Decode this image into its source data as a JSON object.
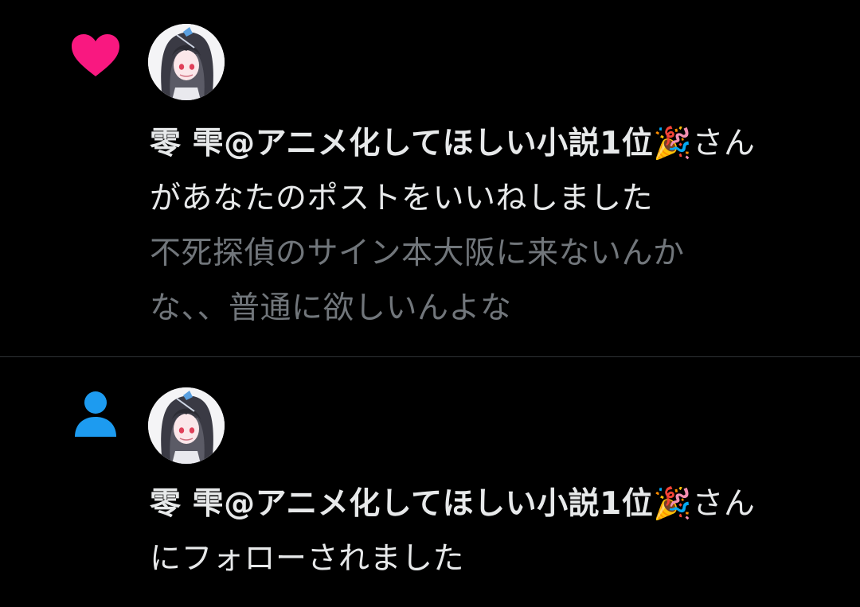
{
  "colors": {
    "background": "#000000",
    "primary_text": "#e7e9ea",
    "secondary_text": "#71767b",
    "like_heart": "#f91880",
    "follow_icon": "#1d9bf0",
    "divider": "#2f3336"
  },
  "notifications": [
    {
      "type": "like",
      "icon": "heart-icon",
      "user_name": "零 雫@アニメ化してほしい小説1位",
      "name_emoji": "🎉",
      "action_line1": "さん",
      "action_line2": "があなたのポストをいいねしました",
      "post_preview_line1": "不死探偵のサイン本大阪に来ないんか",
      "post_preview_line2": "な、、普通に欲しいんよな"
    },
    {
      "type": "follow",
      "icon": "person-icon",
      "user_name": "零 雫@アニメ化してほしい小説1位",
      "name_emoji": "🎉",
      "action_line1": "さん",
      "action_line2": "にフォローされました"
    }
  ]
}
